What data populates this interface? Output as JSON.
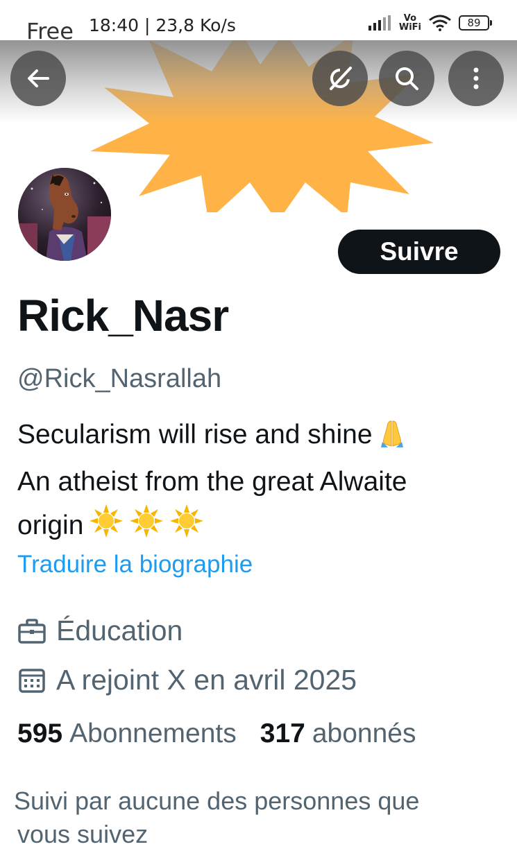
{
  "status_bar": {
    "carrier": "Free",
    "time_speed": "18:40 | 23,8 Ko/s",
    "vowifi_top": "Vo",
    "vowifi_bottom": "WiFi",
    "battery": "89"
  },
  "header": {
    "icons": [
      "back-arrow-icon",
      "grok-icon",
      "search-icon",
      "more-vert-icon"
    ]
  },
  "banner": {
    "shape": "sunburst",
    "color": "#ffb347"
  },
  "profile": {
    "follow_label": "Suivre",
    "display_name": "Rick_Nasr",
    "handle": "@Rick_Nasrallah",
    "bio_line1": "Secularism will rise and shine",
    "bio_line2": "An atheist from the great Alwaite",
    "bio_line3": "origin",
    "translate_label": "Traduire la biographie",
    "category": "Éducation",
    "joined": "A rejoint X en avril 2025",
    "following_count": "595",
    "following_label": "Abonnements",
    "followers_count": "317",
    "followers_label": "abonnés",
    "followed_by_line1": "Suivi par aucune des personnes que",
    "followed_by_line2": "vous suivez"
  },
  "colors": {
    "accent_blue": "#1d9bf0",
    "secondary_text": "#536471",
    "primary_text": "#0f1419",
    "banner_orange": "#ffb347"
  }
}
